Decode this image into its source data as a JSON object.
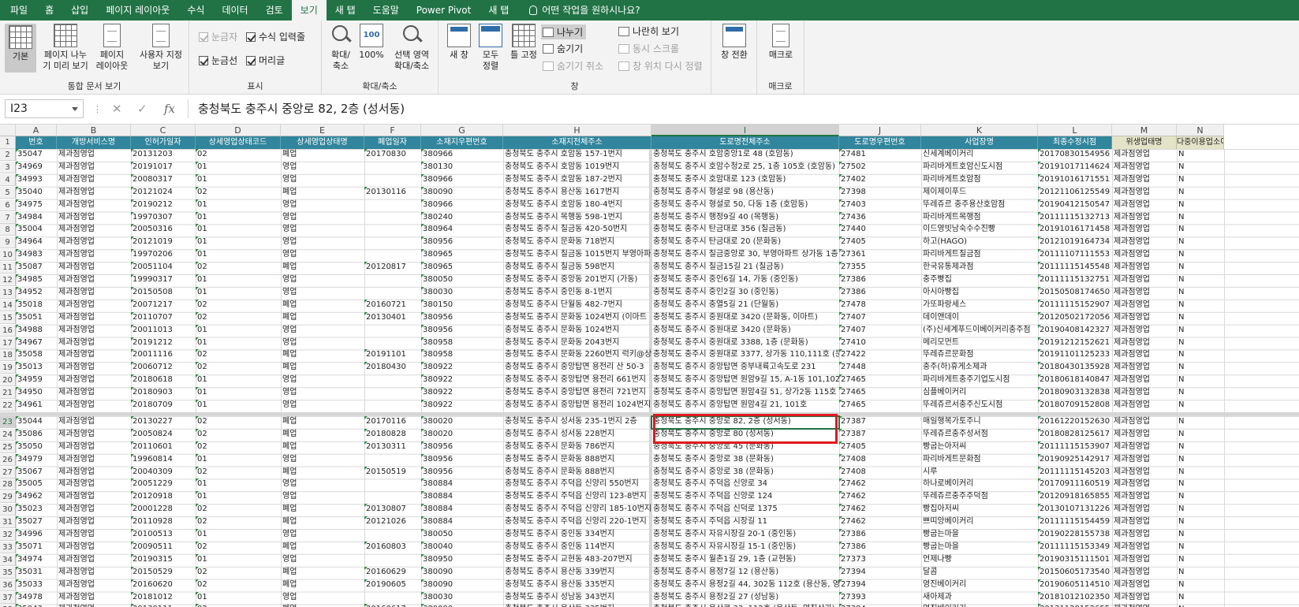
{
  "tabs": [
    "파일",
    "홈",
    "삽입",
    "페이지 레이아웃",
    "수식",
    "데이터",
    "검토",
    "보기",
    "새 탭",
    "도움말",
    "Power Pivot",
    "새 탭",
    "어떤 작업을 원하시나요?"
  ],
  "active_tab_index": 7,
  "ribbon": {
    "workbook_views": {
      "label": "통합 문서 보기",
      "buttons": [
        "기본",
        "페이지 나누\n기 미리 보기",
        "페이지\n레이아웃",
        "사용자 지정\n보기"
      ]
    },
    "show": {
      "label": "표시",
      "items": [
        {
          "text": "눈금자",
          "checked": true,
          "disabled": true
        },
        {
          "text": "수식 입력줄",
          "checked": true,
          "disabled": false
        },
        {
          "text": "눈금선",
          "checked": true,
          "disabled": false
        },
        {
          "text": "머리글",
          "checked": true,
          "disabled": false
        }
      ]
    },
    "zoom": {
      "label": "확대/축소",
      "buttons": [
        "확대/\n축소",
        "100%",
        "선택 영역\n확대/축소"
      ]
    },
    "window": {
      "label": "창",
      "buttons": [
        "새 창",
        "모두\n정렬",
        "틀 고정"
      ],
      "small": [
        {
          "text": "나누기",
          "selected": true,
          "disabled": false
        },
        {
          "text": "숨기기",
          "selected": false,
          "disabled": false
        },
        {
          "text": "숨기기 취소",
          "selected": false,
          "disabled": true
        },
        {
          "text": "나란히 보기",
          "selected": false,
          "disabled": false
        },
        {
          "text": "동시 스크롤",
          "selected": false,
          "disabled": true
        },
        {
          "text": "창 위치 다시 정렬",
          "selected": false,
          "disabled": true
        }
      ],
      "switch": "창 전환"
    },
    "macro": {
      "label": "매크로",
      "button": "매크로"
    }
  },
  "formula_bar": {
    "name_box": "I23",
    "content": "충청북도 충주시 중앙로 82, 2층 (성서동)"
  },
  "columns": [
    {
      "letter": "A",
      "header": "번호"
    },
    {
      "letter": "B",
      "header": "개방서비스명"
    },
    {
      "letter": "C",
      "header": "인허가일자"
    },
    {
      "letter": "D",
      "header": "상세영업상태코드"
    },
    {
      "letter": "E",
      "header": "상세영업상태명"
    },
    {
      "letter": "F",
      "header": "폐업일자"
    },
    {
      "letter": "G",
      "header": "소재지우편번호"
    },
    {
      "letter": "H",
      "header": "소재지전체주소"
    },
    {
      "letter": "I",
      "header": "도로명전체주소"
    },
    {
      "letter": "J",
      "header": "도로명우편번호"
    },
    {
      "letter": "K",
      "header": "사업장명"
    },
    {
      "letter": "L",
      "header": "최종수정시점"
    },
    {
      "letter": "M",
      "header": "위생업태명"
    },
    {
      "letter": "N",
      "header": "다중이용업소여부"
    }
  ],
  "rows": [
    {
      "n": 2,
      "c": [
        "35047",
        "제과점영업",
        "20131203",
        "02",
        "폐업",
        "20170830",
        "380966",
        "충청북도 충주시 호암동 157-1번지",
        "충청북도 충주시 호암중앙1로 48 (호암동)",
        "27481",
        "신세계베이커리",
        "20170830154956",
        "제과점영업",
        "N"
      ]
    },
    {
      "n": 3,
      "c": [
        "34969",
        "제과점영업",
        "20191017",
        "01",
        "영업",
        "",
        "380130",
        "충청북도 충주시 호암동 1019번지",
        "충청북도 충주시 호암수청2로 25, 1층 105호 (호암동)",
        "27502",
        "파리바게트호암신도시점",
        "20191017114624",
        "제과점영업",
        "N"
      ]
    },
    {
      "n": 4,
      "c": [
        "34993",
        "제과점영업",
        "20080317",
        "01",
        "영업",
        "",
        "380966",
        "충청북도 충주시 호암동 187-2번지",
        "충청북도 충주시 호암대로 123 (호암동)",
        "27402",
        "파리바게트호암점",
        "20191016171551",
        "제과점영업",
        "N"
      ]
    },
    {
      "n": 5,
      "c": [
        "35040",
        "제과점영업",
        "20121024",
        "02",
        "폐업",
        "20130116",
        "380090",
        "충청북도 충주시 용산동 1617번지",
        "충청북도 충주시 형설로 98 (용산동)",
        "27398",
        "제이제이푸드",
        "20121106125549",
        "제과점영업",
        "N"
      ]
    },
    {
      "n": 6,
      "c": [
        "34975",
        "제과점영업",
        "20190212",
        "01",
        "영업",
        "",
        "380966",
        "충청북도 충주시 호암동 180-4번지",
        "충청북도 충주시 형설로 50, 다동 1층 (호암동)",
        "27403",
        "뚜레쥬르 충주용산호암점",
        "20190412150547",
        "제과점영업",
        "N"
      ]
    },
    {
      "n": 7,
      "c": [
        "34984",
        "제과점영업",
        "19970307",
        "01",
        "영업",
        "",
        "380240",
        "충청북도 충주시 목행동 598-1번지",
        "충청북도 충주시 행정9길 40 (목행동)",
        "27436",
        "파리바게트목행점",
        "20111115132713",
        "제과점영업",
        "N"
      ]
    },
    {
      "n": 8,
      "c": [
        "35004",
        "제과점영업",
        "20050316",
        "01",
        "영업",
        "",
        "380964",
        "충청북도 충주시 칠금동 420-50번지",
        "충청북도 충주시 탄금대로 356 (칠금동)",
        "27440",
        "이드영빗남숙수수진빵",
        "20191016171458",
        "제과점영업",
        "N"
      ]
    },
    {
      "n": 9,
      "c": [
        "34964",
        "제과점영업",
        "20121019",
        "01",
        "영업",
        "",
        "380956",
        "충청북도 충주시 문화동 718번지",
        "충청북도 충주시 탄금대로 20 (문화동)",
        "27405",
        "하고(HAGO)",
        "20121019164734",
        "제과점영업",
        "N"
      ]
    },
    {
      "n": 10,
      "c": [
        "34983",
        "제과점영업",
        "19970206",
        "01",
        "영업",
        "",
        "380965",
        "충청북도 충주시 칠금동 1015번지 부영아파트",
        "충청북도 충주시 칠금중앙로 30, 부영아파트 상가동 1층",
        "27361",
        "파리바게트칠금점",
        "20111107111553",
        "제과점영업",
        "N"
      ]
    },
    {
      "n": 11,
      "c": [
        "35087",
        "제과점영업",
        "20051104",
        "02",
        "폐업",
        "20120817",
        "380965",
        "충청북도 충주시 칠금동 598번지",
        "충청북도 충주시 칠금15길 21 (칠금동)",
        "27355",
        "한국유통제과점",
        "20111115145548",
        "제과점영업",
        "N"
      ]
    },
    {
      "n": 12,
      "c": [
        "34985",
        "제과점영업",
        "19990317",
        "01",
        "영업",
        "",
        "380050",
        "충청북도 충주시 중앙동 201번지 (가동)",
        "충청북도 충주시 중인6길 14, 가동 (중인동)",
        "27386",
        "충주빵집",
        "20111115132751",
        "제과점영업",
        "N"
      ]
    },
    {
      "n": 13,
      "c": [
        "34952",
        "제과점영업",
        "20150508",
        "01",
        "영업",
        "",
        "380030",
        "충청북도 충주시 중인동 8-1번지",
        "충청북도 충주시 중인2길 30 (중인동)",
        "27386",
        "아시아빵집",
        "20150508174650",
        "제과점영업",
        "N"
      ]
    },
    {
      "n": 14,
      "c": [
        "35018",
        "제과점영업",
        "20071217",
        "02",
        "폐업",
        "20160721",
        "380150",
        "충청북도 충주시 단월동 482-7번지",
        "충청북도 충주시 충열5길 21 (단월동)",
        "27478",
        "가또파랑세스",
        "20111115152907",
        "제과점영업",
        "N"
      ]
    },
    {
      "n": 15,
      "c": [
        "35051",
        "제과점영업",
        "20110707",
        "02",
        "폐업",
        "20130401",
        "380956",
        "충청북도 충주시 문화동 1024번지 (이마트",
        "충청북도 충주시 중원대로 3420 (문화동, 이마트)",
        "27407",
        "데이앤데이",
        "20120502172056",
        "제과점영업",
        "N"
      ]
    },
    {
      "n": 16,
      "c": [
        "34988",
        "제과점영업",
        "20011013",
        "01",
        "영업",
        "",
        "380956",
        "충청북도 충주시 문화동 1024번지",
        "충청북도 충주시 중원대로 3420 (문화동)",
        "27407",
        "(주)신세계푸드이베이커리충주점",
        "20190408142327",
        "제과점영업",
        "N"
      ]
    },
    {
      "n": 17,
      "c": [
        "34967",
        "제과점영업",
        "20191212",
        "01",
        "영업",
        "",
        "380958",
        "충청북도 충주시 문화동 2043번지",
        "충청북도 충주시 중원대로 3388, 1층 (문화동)",
        "27410",
        "메리모먼트",
        "20191212152621",
        "제과점영업",
        "N"
      ]
    },
    {
      "n": 18,
      "c": [
        "35058",
        "제과점영업",
        "20011116",
        "02",
        "폐업",
        "20191101",
        "380958",
        "충청북도 충주시 문화동 2260번지 럭키@상",
        "충청북도 충주시 중원대로 3377, 상가동 110,111호 (문화동)",
        "27422",
        "뚜레쥬르문화점",
        "20191101125233",
        "제과점영업",
        "N"
      ]
    },
    {
      "n": 19,
      "c": [
        "35013",
        "제과점영업",
        "20060712",
        "02",
        "폐업",
        "20180430",
        "380922",
        "충청북도 충주시 중앙탑면 용전리 산 50-3",
        "충청북도 충주시 중앙탑면 중부내륙고속도로 231",
        "27448",
        "충주(하)휴게소제과",
        "20180430135928",
        "제과점영업",
        "N"
      ]
    },
    {
      "n": 20,
      "c": [
        "34959",
        "제과점영업",
        "20180618",
        "01",
        "영업",
        "",
        "380922",
        "충청북도 충주시 중앙탑면 용전리 661번지",
        "충청북도 충주시 중앙탑면 원암9길 15, A-1동 101,102호",
        "27465",
        "파리바게트충주기업도시점",
        "20180618140847",
        "제과점영업",
        "N"
      ]
    },
    {
      "n": 21,
      "c": [
        "34950",
        "제과점영업",
        "20180903",
        "01",
        "영업",
        "",
        "380922",
        "충청북도 충주시 중앙탑면 용전리 721번지",
        "충청북도 충주시 중앙탑면 원암4길 51, 상가2동 115호",
        "27465",
        "심플베이커리",
        "20180903132838",
        "제과점영업",
        "N"
      ]
    },
    {
      "n": 22,
      "c": [
        "34961",
        "제과점영업",
        "20180709",
        "01",
        "영업",
        "",
        "380922",
        "충청북도 충주시 중앙탑면 용전리 1024번지",
        "충청북도 충주시 중앙탑면 원암4길 21, 101호",
        "27465",
        "뚜레쥬르서충주신도시점",
        "20180709152808",
        "제과점영업",
        "N"
      ]
    },
    {
      "n": 23,
      "c": [
        "35044",
        "제과점영업",
        "20130227",
        "02",
        "폐업",
        "20170116",
        "380020",
        "충청북도 충주시 성서동 235-1번지 2층",
        "충청북도 충주시 중앙로 82, 2층 (성서동)",
        "27387",
        "매일행복가토주니",
        "20161220152630",
        "제과점영업",
        "N"
      ]
    },
    {
      "n": 24,
      "c": [
        "35086",
        "제과점영업",
        "20050824",
        "02",
        "폐업",
        "20180828",
        "380020",
        "충청북도 충주시 성서동 228번지",
        "충청북도 충주시 중앙로 80 (성서동)",
        "27387",
        "뚜레쥬르충주성서점",
        "20180828125617",
        "제과점영업",
        "N"
      ]
    },
    {
      "n": 25,
      "c": [
        "35050",
        "제과점영업",
        "20110601",
        "02",
        "폐업",
        "20130311",
        "380956",
        "충청북도 충주시 문화동 786번지",
        "충청북도 충주시 중앙로 45 (문화동)",
        "27405",
        "빵굽는아저씨",
        "20111115153907",
        "제과점영업",
        "N"
      ]
    },
    {
      "n": 26,
      "c": [
        "34979",
        "제과점영업",
        "19960814",
        "01",
        "영업",
        "",
        "380956",
        "충청북도 충주시 문화동 888번지",
        "충청북도 충주시 중앙로 38 (문화동)",
        "27408",
        "파리바게트문화점",
        "20190925142917",
        "제과점영업",
        "N"
      ]
    },
    {
      "n": 27,
      "c": [
        "35067",
        "제과점영업",
        "20040309",
        "02",
        "폐업",
        "20150519",
        "380956",
        "충청북도 충주시 문화동 888번지",
        "충청북도 충주시 중앙로 38 (문화동)",
        "27408",
        "시루",
        "20111115145203",
        "제과점영업",
        "N"
      ]
    },
    {
      "n": 28,
      "c": [
        "35005",
        "제과점영업",
        "20051229",
        "01",
        "영업",
        "",
        "380884",
        "충청북도 충주시 주덕읍 신양리 550번지",
        "충청북도 충주시 주덕읍 신양로 34",
        "27462",
        "하나로베이커리",
        "20170911160519",
        "제과점영업",
        "N"
      ]
    },
    {
      "n": 29,
      "c": [
        "34962",
        "제과점영업",
        "20120918",
        "01",
        "영업",
        "",
        "380884",
        "충청북도 충주시 주덕읍 신양리 123-8번지",
        "충청북도 충주시 주덕읍 신양로 124",
        "27462",
        "뚜레쥬르충주주덕점",
        "20120918165855",
        "제과점영업",
        "N"
      ]
    },
    {
      "n": 30,
      "c": [
        "35023",
        "제과점영업",
        "20001228",
        "02",
        "폐업",
        "20130807",
        "380884",
        "충청북도 충주시 주덕읍 신양리 185-10번지",
        "충청북도 충주시 주덕읍 신덕로 1375",
        "27462",
        "빵집아저씨",
        "20130107131226",
        "제과점영업",
        "N"
      ]
    },
    {
      "n": 31,
      "c": [
        "35027",
        "제과점영업",
        "20110928",
        "02",
        "폐업",
        "20121026",
        "380884",
        "충청북도 충주시 주덕읍 신양리 220-1번지",
        "충청북도 충주시 주덕읍 시장길 11",
        "27462",
        "쁘띠앙베이커리",
        "20111115154459",
        "제과점영업",
        "N"
      ]
    },
    {
      "n": 32,
      "c": [
        "34996",
        "제과점영업",
        "20100513",
        "01",
        "영업",
        "",
        "380050",
        "충청북도 충주시 중인동 334번지",
        "충청북도 충주시 자유시장길 20-1 (중인동)",
        "27386",
        "빵굽는마을",
        "20190228155738",
        "제과점영업",
        "N"
      ]
    },
    {
      "n": 33,
      "c": [
        "35071",
        "제과점영업",
        "20090511",
        "02",
        "폐업",
        "20160803",
        "380040",
        "충청북도 충주시 중인동 114번지",
        "충청북도 충주시 자유시장길 15-1 (중인동)",
        "27386",
        "빵굽는마을",
        "20111115153349",
        "제과점영업",
        "N"
      ]
    },
    {
      "n": 34,
      "c": [
        "34974",
        "제과점영업",
        "20190315",
        "01",
        "영업",
        "",
        "380950",
        "충청북도 충주시 교현동 483-207번지",
        "충청북도 충주시 월촌1길 29, 1층 (교현동)",
        "27373",
        "언제나빵",
        "20190315111501",
        "제과점영업",
        "N"
      ]
    },
    {
      "n": 35,
      "c": [
        "35031",
        "제과점영업",
        "20150529",
        "02",
        "폐업",
        "20160629",
        "380090",
        "충청북도 충주시 용산동 339번지",
        "충청북도 충주시 용정7길 12 (용산동)",
        "27394",
        "달콤",
        "20150605173540",
        "제과점영업",
        "N"
      ]
    },
    {
      "n": 36,
      "c": [
        "35033",
        "제과점영업",
        "20160620",
        "02",
        "폐업",
        "20190605",
        "380090",
        "충청북도 충주시 용산동 335번지",
        "충청북도 충주시 용정2길 44, 302동 112호 (용산동, 영",
        "27394",
        "영진베이커리",
        "20190605114510",
        "제과점영업",
        "N"
      ]
    },
    {
      "n": 37,
      "c": [
        "34978",
        "제과점영업",
        "20181012",
        "01",
        "영업",
        "",
        "380030",
        "충청북도 충주시 성남동 343번지",
        "충청북도 충주시 용정2길 27 (성남동)",
        "27393",
        "새아제과",
        "20181012102350",
        "제과점영업",
        "N"
      ]
    },
    {
      "n": 38,
      "c": [
        "35043",
        "제과점영업",
        "20130111",
        "02",
        "폐업",
        "20160617",
        "380090",
        "충청북도 충주시 용산동 335번지",
        "충청북도 충주시 용산로 33, 112호 (용산동, 영진상가)",
        "27394",
        "영진베이커리",
        "20131128152655",
        "제과점영업",
        "N"
      ]
    },
    {
      "n": 39,
      "c": [
        "35008",
        "제과점영업",
        "20071015",
        "01",
        "영업",
        "",
        "380962",
        "충청북도 충주시 연수동 665-3번지",
        "충청북도 충주시 예성로 392 (연수동)",
        "27342",
        "뚜레쥬르연수롯데점",
        "20111115152608",
        "제과점영업",
        "N"
      ]
    }
  ],
  "active_cell": {
    "col": "I",
    "row": 23
  },
  "highlight": {
    "col": "I",
    "rows": [
      23,
      24
    ],
    "color": "#e0191f"
  }
}
